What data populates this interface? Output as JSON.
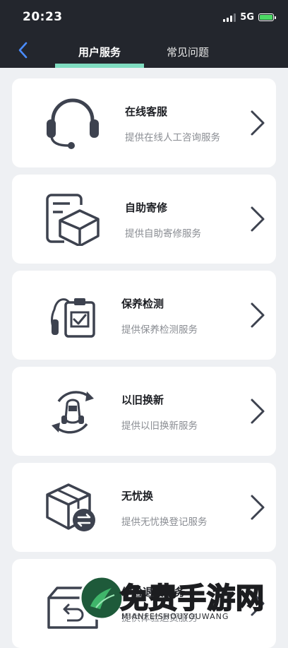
{
  "status_bar": {
    "time": "20:23",
    "network": "5G"
  },
  "tabs": [
    {
      "label": "用户服务",
      "active": true
    },
    {
      "label": "常见问题",
      "active": false
    }
  ],
  "colors": {
    "header_bg": "#23262d",
    "accent": "#7fdcc0",
    "back_arrow": "#4a8cff",
    "icon": "#3d424f"
  },
  "services": [
    {
      "title": "在线客服",
      "subtitle": "提供在线人工咨询服务",
      "icon": "headset-icon"
    },
    {
      "title": "自助寄修",
      "subtitle": "提供自助寄修服务",
      "icon": "package-document-icon"
    },
    {
      "title": "保养检测",
      "subtitle": "提供保养检测服务",
      "icon": "scooter-checklist-icon"
    },
    {
      "title": "以旧换新",
      "subtitle": "提供以旧换新服务",
      "icon": "scooter-cycle-icon"
    },
    {
      "title": "无忧换",
      "subtitle": "提供无忧换登记服务",
      "icon": "box-exchange-icon"
    },
    {
      "title": "体验退货服务",
      "subtitle": "提供体验退货服务",
      "icon": "box-return-icon"
    }
  ],
  "watermark": {
    "text": "免费手游网",
    "subtext": "MIANFEISHOUYOUWANG"
  }
}
